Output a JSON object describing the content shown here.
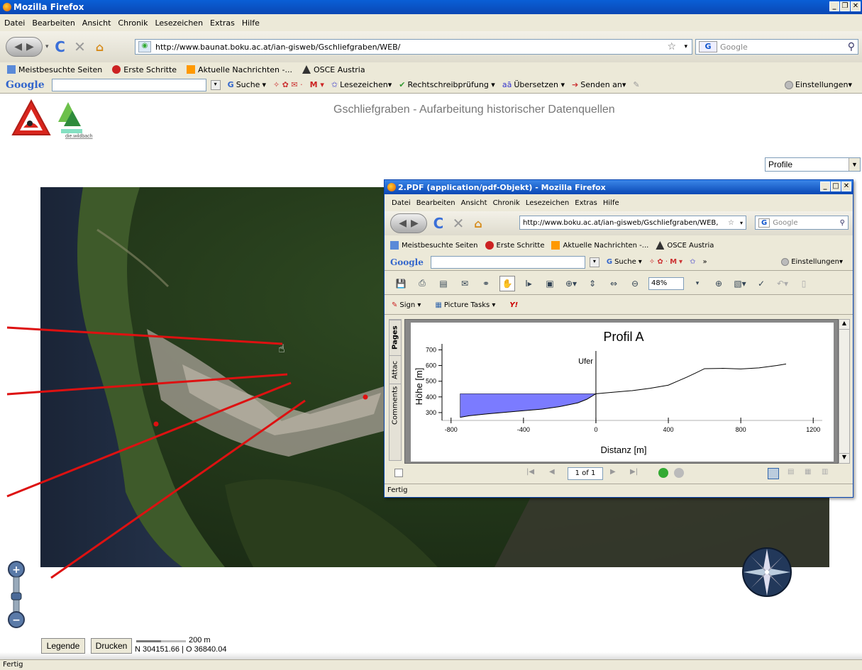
{
  "browser": {
    "window_title": "Mozilla Firefox",
    "menu": [
      "Datei",
      "Bearbeiten",
      "Ansicht",
      "Chronik",
      "Lesezeichen",
      "Extras",
      "Hilfe"
    ],
    "url": "http://www.baunat.boku.ac.at/ian-gisweb/Gschliefgraben/WEB/",
    "search_placeholder": "Google",
    "bookmarks": [
      "Meistbesuchte Seiten",
      "Erste Schritte",
      "Aktuelle Nachrichten -...",
      "OSCE Austria"
    ],
    "google_toolbar": {
      "logo": "Google",
      "search_label": "Suche",
      "items": [
        "Lesezeichen▾",
        "Rechtschreibprüfung ▾",
        "Übersetzen ▾",
        "Senden an▾"
      ],
      "settings": "Einstellungen▾"
    },
    "status": "Fertig"
  },
  "page": {
    "title": "Gschliefgraben - Aufarbeitung historischer Datenquellen",
    "logo2_text": "die.wildbach",
    "layer_select": "Profile",
    "legend_button": "Legende",
    "print_button": "Drucken",
    "scale_label": "200 m",
    "coordinates": "N 304151.66 | O 36840.04"
  },
  "popup": {
    "window_title": "2.PDF (application/pdf-Objekt) - Mozilla Firefox",
    "menu": [
      "Datei",
      "Bearbeiten",
      "Ansicht",
      "Chronik",
      "Lesezeichen",
      "Extras",
      "Hilfe"
    ],
    "url": "http://www.boku.ac.at/ian-gisweb/Gschliefgraben/WEB,",
    "search_placeholder": "Google",
    "bookmarks": [
      "Meistbesuchte Seiten",
      "Erste Schritte",
      "Aktuelle Nachrichten -...",
      "OSCE Austria"
    ],
    "google_logo": "Google",
    "google_search_label": "Suche",
    "google_more": "»",
    "google_settings": "Einstellungen▾",
    "zoom": "48%",
    "sign_label": "Sign ▾",
    "picture_tasks_label": "Picture Tasks ▾",
    "side_tabs": [
      "Pages",
      "Attac",
      "Comments"
    ],
    "page_indicator": "1 of 1",
    "status": "Fertig"
  },
  "chart_data": {
    "type": "line",
    "title": "Profil A",
    "xlabel": "Distanz [m]",
    "ylabel": "Höhe [m]",
    "xlim": [
      -850,
      1250
    ],
    "ylim": [
      250,
      720
    ],
    "xticks": [
      -800,
      -400,
      0,
      400,
      800,
      1200
    ],
    "yticks": [
      300,
      400,
      500,
      600,
      700
    ],
    "annotation": "Ufer",
    "annotation_x": 0,
    "fill_color": "#7b7bff",
    "series": [
      {
        "x": [
          -750,
          -700,
          -600,
          -500,
          -400,
          -300,
          -200,
          -100,
          -50,
          0,
          50,
          100,
          200,
          300,
          400,
          450,
          500,
          550,
          600,
          700,
          800,
          900,
          1000,
          1050
        ],
        "y": [
          270,
          280,
          292,
          302,
          312,
          322,
          338,
          362,
          385,
          420,
          425,
          430,
          440,
          455,
          475,
          500,
          525,
          552,
          580,
          582,
          578,
          585,
          600,
          610
        ]
      }
    ],
    "lake_surface": 420
  }
}
